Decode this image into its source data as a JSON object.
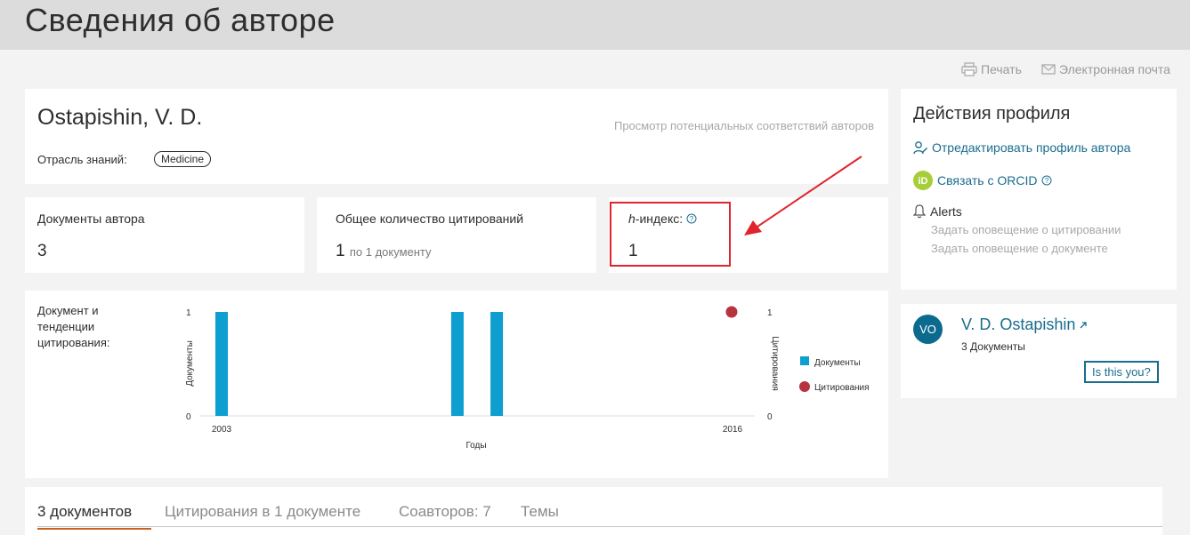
{
  "page": {
    "title": "Сведения об авторе"
  },
  "toolbar": {
    "print_label": "Печать",
    "email_label": "Электронная почта"
  },
  "author": {
    "name": "Ostapishin, V. D.",
    "subject_label": "Отрасль знаний:",
    "subject": "Medicine",
    "view_matches": "Просмотр потенциальных соответствий авторов"
  },
  "metrics": {
    "documents_label": "Документы автора",
    "documents_value": "3",
    "citations_label": "Общее количество цитирований",
    "citations_value": "1",
    "citations_sub": "по 1 документу",
    "hindex_italic": "h",
    "hindex_label": "-индекс:",
    "hindex_value": "1"
  },
  "chart_label": "Документ и тенденции цитирования:",
  "chart_data": {
    "type": "bar",
    "x_ticks": [
      "2003",
      "2016"
    ],
    "xlabel": "Годы",
    "ylabel_left": "Документы",
    "ylabel_right": "Цитирования",
    "ylim": [
      0,
      1
    ],
    "y_ticks": [
      "0",
      "1"
    ],
    "series": [
      {
        "name": "Документы",
        "type": "bar",
        "color": "#0e9fd0",
        "points": [
          {
            "x": 2003,
            "y": 1
          },
          {
            "x": 2009,
            "y": 1
          },
          {
            "x": 2010,
            "y": 1
          }
        ]
      },
      {
        "name": "Цитирования",
        "type": "scatter",
        "color": "#b6343e",
        "points": [
          {
            "x": 2016,
            "y": 1
          }
        ]
      }
    ],
    "legend_position": "right"
  },
  "profile_actions": {
    "title": "Действия профиля",
    "edit": "Отредактировать профиль автора",
    "orcid": "Связать с ORCID",
    "alerts": "Alerts",
    "alert_citations": "Задать оповещение о цитировании",
    "alert_documents": "Задать оповещение о документе"
  },
  "author_card": {
    "initials": "VO",
    "name": "V. D. Ostapishin",
    "docs": "3 Документы",
    "is_this_you": "Is this you?"
  },
  "tabs": [
    {
      "label": "3 документов"
    },
    {
      "label": "Цитирования в 1 документе"
    },
    {
      "label": "Соавторов: 7"
    },
    {
      "label": "Темы"
    }
  ],
  "colors": {
    "accent": "#1a6d8e",
    "bar": "#0e9fd0",
    "citation": "#b6343e",
    "highlight": "#e0242c",
    "tab_underline": "#c5621d"
  }
}
